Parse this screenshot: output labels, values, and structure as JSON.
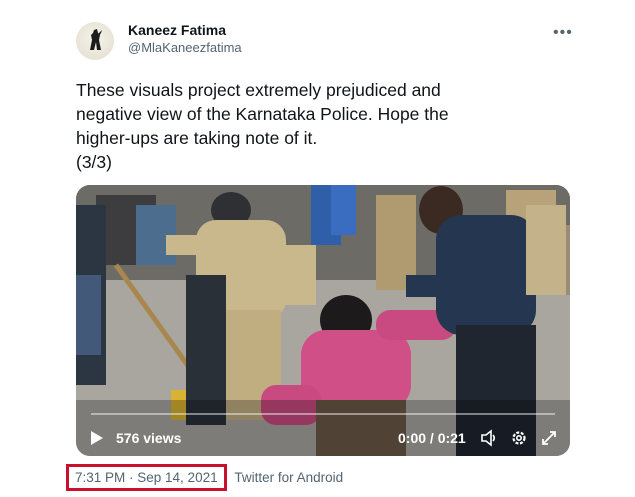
{
  "author": {
    "name": "Kaneez Fatima",
    "handle": "@MlaKaneezfatima"
  },
  "more_icon": "more-horizontal-icon",
  "tweet_text": [
    "These visuals project extremely prejudiced and",
    "negative view of the Karnataka Police. Hope the",
    "higher-ups are taking note of it.",
    "(3/3)"
  ],
  "video": {
    "views": "576 views",
    "time": "0:00 / 0:21",
    "progress": 0,
    "icons": [
      "play-icon",
      "volume-icon",
      "settings-icon",
      "fullscreen-icon"
    ]
  },
  "meta": {
    "timestamp": "7:31 PM · Sep 14, 2021",
    "client": "Twitter for Android",
    "highlight_color": "#c8102e"
  }
}
